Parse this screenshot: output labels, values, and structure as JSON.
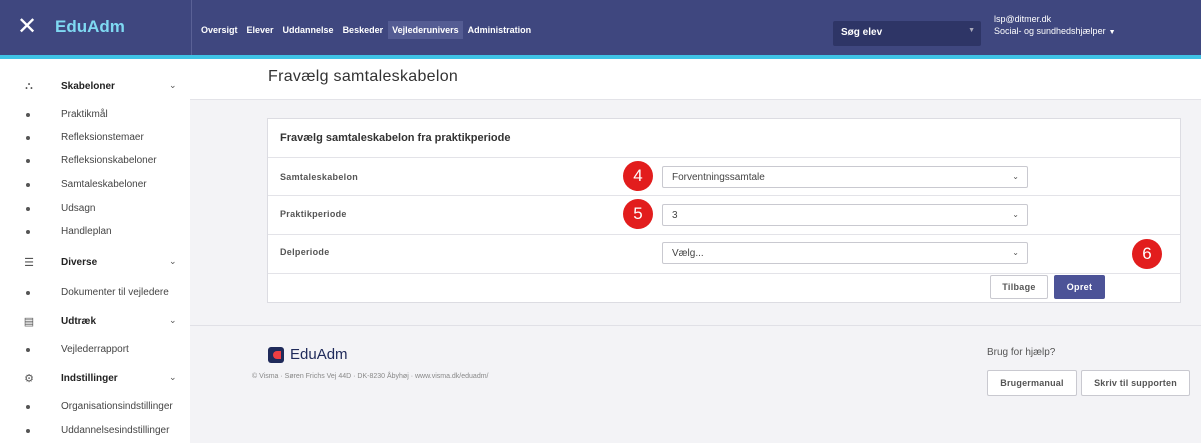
{
  "app": {
    "close_icon": "close-icon",
    "brand": "EduAdm"
  },
  "nav": [
    "Oversigt",
    "Elever",
    "Uddannelse",
    "Beskeder",
    "Vejlederunivers",
    "Administration"
  ],
  "search": {
    "label": "Søg elev"
  },
  "user": {
    "email": "lsp@ditmer.dk",
    "role": "Social- og sundhedshjælper"
  },
  "sidebar": {
    "sections": [
      {
        "label": "Skabeloner",
        "icon": "org-chart-icon"
      },
      {
        "label": "Diverse",
        "icon": "list-icon"
      },
      {
        "label": "Udtræk",
        "icon": "document-icon"
      },
      {
        "label": "Indstillinger",
        "icon": "gear-icon"
      }
    ],
    "skabeloner_items": [
      "Praktikmål",
      "Refleksionstemaer",
      "Refleksionskabeloner",
      "Samtaleskabeloner",
      "Udsagn",
      "Handleplan"
    ],
    "diverse_items": [
      "Dokumenter til vejledere"
    ],
    "udtraek_items": [
      "Vejlederrapport"
    ],
    "indstillinger_items": [
      "Organisationsindstillinger",
      "Uddannelsesindstillinger"
    ]
  },
  "page": {
    "title": "Fravælg samtaleskabelon"
  },
  "form": {
    "card_title": "Fravælg samtaleskabelon fra praktikperiode",
    "rows": [
      {
        "label": "Samtaleskabelon",
        "value": "Forventningssamtale",
        "badge": "4"
      },
      {
        "label": "Praktikperiode",
        "value": "3",
        "badge": "5"
      },
      {
        "label": "Delperiode",
        "value": "Vælg..."
      }
    ],
    "back_label": "Tilbage",
    "create_label": "Opret",
    "create_badge": "6"
  },
  "footer": {
    "logo_text": "EduAdm",
    "address": "© Visma · Søren Frichs Vej 44D · DK-8230 Åbyhøj · www.visma.dk/eduadm/",
    "help_text": "Brug for hjælp?",
    "manual_label": "Brugermanual",
    "support_label": "Skriv til supporten"
  },
  "colors": {
    "topbar": "#3f477f",
    "accent": "#3ec3e6",
    "primary_button": "#4c5397",
    "badge": "#e21d1d"
  }
}
